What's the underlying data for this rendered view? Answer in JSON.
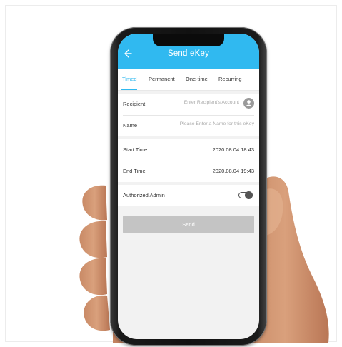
{
  "header": {
    "title": "Send eKey",
    "back_icon": "arrow-left-icon"
  },
  "tabs": [
    {
      "label": "Timed",
      "active": true
    },
    {
      "label": "Permanent",
      "active": false
    },
    {
      "label": "One-time",
      "active": false
    },
    {
      "label": "Recurring",
      "active": false
    }
  ],
  "form": {
    "recipient": {
      "label": "Recipient",
      "placeholder": "Enter Recipient's Account",
      "icon": "contact-icon"
    },
    "name": {
      "label": "Name",
      "placeholder": "Please Enter a Name for this eKey"
    },
    "start_time": {
      "label": "Start Time",
      "value": "2020.08.04 18:43"
    },
    "end_time": {
      "label": "End Time",
      "value": "2020.08.04 19:43"
    },
    "authorized_admin": {
      "label": "Authorized Admin",
      "enabled": false
    }
  },
  "actions": {
    "send_label": "Send"
  },
  "colors": {
    "accent": "#30b9f0",
    "button_disabled": "#c4c4c4",
    "background": "#f2f2f2"
  }
}
